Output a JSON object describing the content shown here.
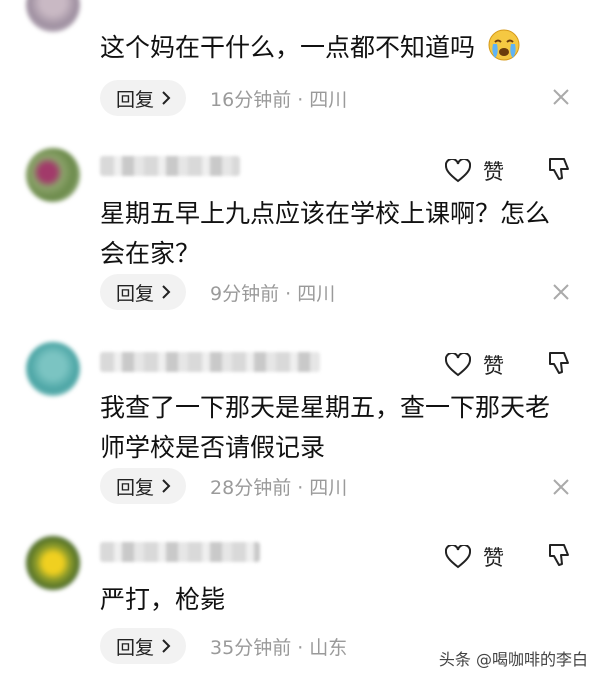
{
  "comments": [
    {
      "text": "这个妈在干什么，一点都不知道吗",
      "reply_label": "回复",
      "time": "16分钟前 · 四川"
    },
    {
      "like_label": "赞",
      "text": "星期五早上九点应该在学校上课啊？怎么会在家？",
      "reply_label": "回复",
      "time": "9分钟前 · 四川"
    },
    {
      "like_label": "赞",
      "text": "我查了一下那天是星期五，查一下那天老师学校是否请假记录",
      "reply_label": "回复",
      "time": "28分钟前 · 四川"
    },
    {
      "like_label": "赞",
      "text": "严打，枪毙",
      "reply_label": "回复",
      "time": "35分钟前 · 山东"
    }
  ],
  "watermark": "头条 @喝咖啡的李白",
  "icons": {
    "like": "heart-outline-icon",
    "dislike": "thumbs-down-icon",
    "close": "close-icon",
    "chevron": "chevron-right-icon",
    "emoji": "crying-face-emoji-icon"
  }
}
